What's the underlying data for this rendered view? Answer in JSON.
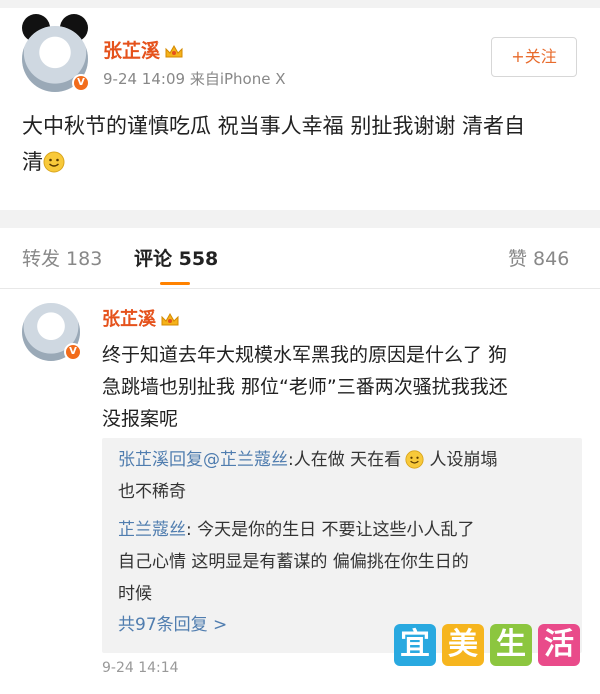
{
  "post": {
    "username": "张芷溪",
    "time": "9-24 14:09",
    "source": "来自iPhone X",
    "follow_label": "+关注",
    "content_line1": "大中秋节的谨慎吃瓜 祝当事人幸福 别扯我谢谢 清者自",
    "content_line2": "清"
  },
  "tabs": {
    "repost": "转发 183",
    "comments": "评论 558",
    "likes": "赞 846"
  },
  "comment": {
    "username": "张芷溪",
    "line1": "终于知道去年大规模水军黑我的原因是什么了 狗",
    "line2": "急跳墙也别扯我 那位“老师”三番两次骚扰我我还",
    "line3": "没报案呢",
    "time": "9-24 14:14"
  },
  "replies": {
    "r1_author": "张芷溪回复@芷兰蔻丝",
    "r1_text_a": ":人在做 天在看",
    "r1_text_b": " 人设崩塌",
    "r1_text_c": "也不稀奇",
    "r2_author": "芷兰蔻丝",
    "r2_text_a": ": 今天是你的生日  不要让这些小人乱了",
    "r2_text_b": "自己心情  这明显是有蓄谋的  偏偏挑在你生日的",
    "r2_text_c": "时候",
    "more": "共97条回复 >"
  },
  "watermark": [
    "宜",
    "美",
    "生",
    "活"
  ],
  "colors": {
    "username": "#e5521c",
    "link_blue": "#507daf",
    "tab_accent": "#ff8200",
    "wm": [
      "#29a9e0",
      "#f6b51e",
      "#8cc63f",
      "#e94b8a"
    ]
  },
  "icons": [
    "crown-badge-icon",
    "verified-v-icon",
    "smile-emoji-icon"
  ]
}
